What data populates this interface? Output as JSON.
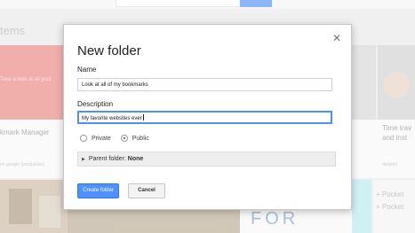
{
  "background": {
    "title": "tems",
    "left_card_text": "Take a look at all your",
    "left_card_title": "kmark Manager",
    "left_card_sub": "tm google (productive)",
    "right_card_title": "Time trav",
    "right_card_title2": "and inst",
    "right_card_sub": "dailytelr",
    "pocket_line1": "+ Pocket",
    "pocket_line2": "+ Pocket",
    "bottom_text": "FOR"
  },
  "dialog": {
    "title": "New folder",
    "close_glyph": "✕",
    "name_label": "Name",
    "name_value": "Look at all of my bookmarks",
    "description_label": "Description",
    "description_value": "My favorite websites ever",
    "visibility_options": [
      {
        "label": "Private",
        "selected": false
      },
      {
        "label": "Public",
        "selected": true
      }
    ],
    "parent_folder_label": "Parent folder:",
    "parent_folder_value": "None",
    "create_button": "Create folder",
    "cancel_button": "Cancel"
  },
  "colors": {
    "accent": "#4d90fe",
    "dialog_bg": "#ffffff",
    "parent_bar_bg": "#eeeeee"
  }
}
